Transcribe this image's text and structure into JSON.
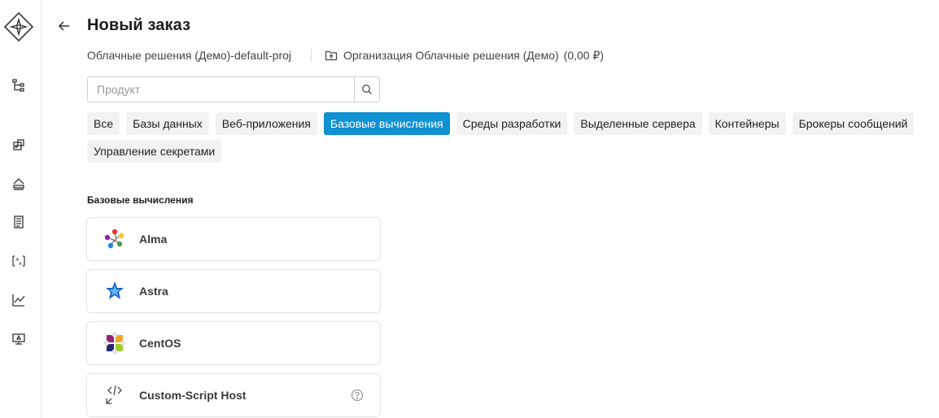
{
  "sidebar": {
    "logo": "diamond-logo",
    "items": [
      {
        "name": "hierarchy-icon"
      },
      {
        "name": "services-icon"
      },
      {
        "name": "cloud-storage-icon"
      },
      {
        "name": "orders-list-icon"
      },
      {
        "name": "translate-icon"
      },
      {
        "name": "analytics-icon"
      },
      {
        "name": "monitor-settings-icon"
      }
    ]
  },
  "header": {
    "back_icon": "arrow-left-icon",
    "title": "Новый заказ",
    "project": "Облачные решения (Демо)-default-proj",
    "org_icon": "folder-upload-icon",
    "organization": "Организация Облачные решения (Демо)",
    "balance": "(0,00 ₽)"
  },
  "search": {
    "placeholder": "Продукт",
    "value": "",
    "icon": "search-icon"
  },
  "tabs": [
    {
      "label": "Все",
      "active": false
    },
    {
      "label": "Базы данных",
      "active": false
    },
    {
      "label": "Веб-приложения",
      "active": false
    },
    {
      "label": "Базовые вычисления",
      "active": true
    },
    {
      "label": "Среды разработки",
      "active": false
    },
    {
      "label": "Выделенные сервера",
      "active": false
    },
    {
      "label": "Контейнеры",
      "active": false
    },
    {
      "label": "Брокеры сообщений",
      "active": false
    },
    {
      "label": "Управление секретами",
      "active": false
    }
  ],
  "section": {
    "title": "Базовые вычисления",
    "products": [
      {
        "label": "Alma",
        "icon": "alma-logo-icon"
      },
      {
        "label": "Astra",
        "icon": "astra-logo-icon"
      },
      {
        "label": "CentOS",
        "icon": "centos-logo-icon"
      },
      {
        "label": "Custom-Script Host",
        "icon": "code-icon",
        "help": "help-icon"
      }
    ]
  },
  "colors": {
    "accent": "#0f91d2",
    "tab_bg": "#f2f2f2",
    "border": "#e2e2e2"
  }
}
